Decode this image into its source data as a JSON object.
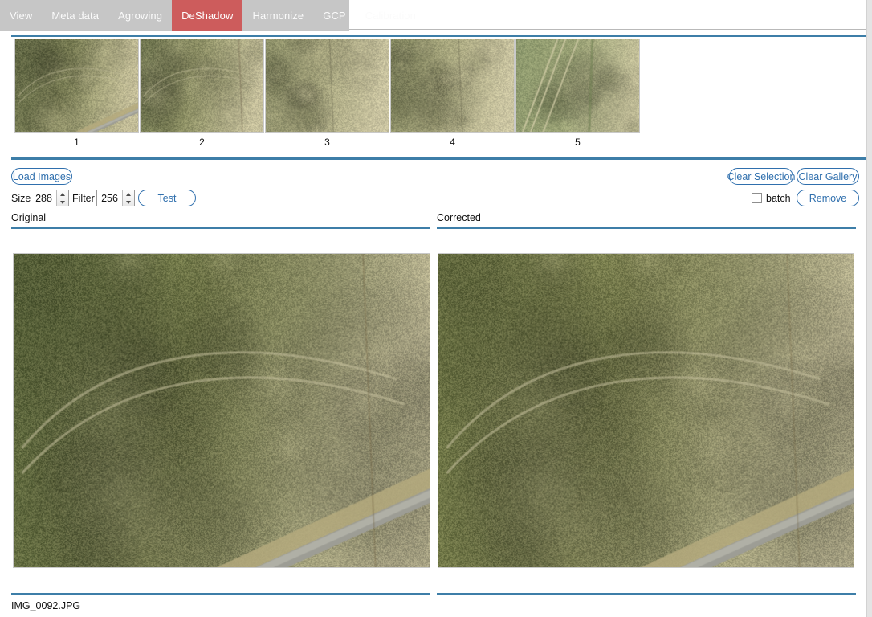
{
  "window": {
    "title": "DeShadow"
  },
  "tabs": [
    {
      "label": "View",
      "active": false
    },
    {
      "label": "Meta data",
      "active": false
    },
    {
      "label": "Agrowing",
      "active": false
    },
    {
      "label": "DeShadow",
      "active": true
    },
    {
      "label": "Harmonize",
      "active": false
    },
    {
      "label": "GCP",
      "active": false
    },
    {
      "label": "Calibration",
      "active": false
    }
  ],
  "colors": {
    "tabbar_background": "#c6c6c6",
    "active_tab": "#cd5c5c",
    "rule_blue": "#3d7ea8",
    "button_blue": "#2f6fad"
  },
  "gallery": {
    "thumbnails": [
      {
        "label": "1"
      },
      {
        "label": "2"
      },
      {
        "label": "3"
      },
      {
        "label": "4"
      },
      {
        "label": "5"
      }
    ]
  },
  "toolbar": {
    "load_images_label": "Load Images",
    "clear_selection_label": "Clear Selection",
    "clear_gallery_label": "Clear Gallery",
    "size_label": "Size",
    "size_value": "288",
    "filter_label": "Filter",
    "filter_value": "256",
    "test_label": "Test",
    "batch_label": "batch",
    "batch_checked": false,
    "remove_label": "Remove"
  },
  "panels": {
    "original_title": "Original",
    "corrected_title": "Corrected",
    "filename": "IMG_0092.JPG"
  }
}
